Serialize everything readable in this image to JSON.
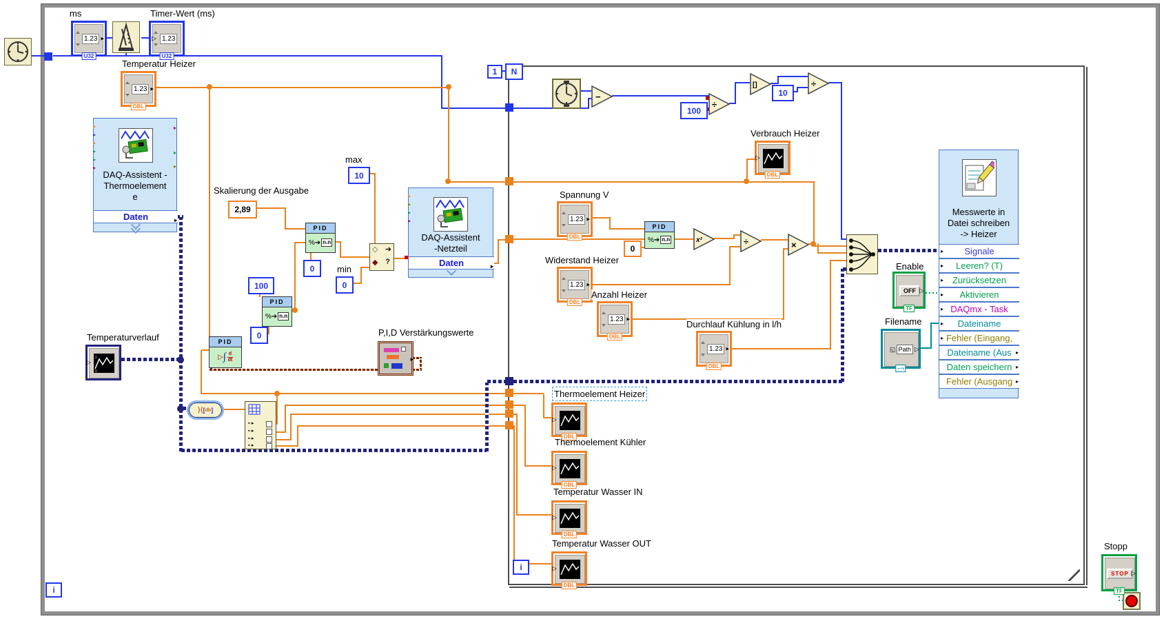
{
  "d": {
    "value_display": "1.23",
    "one": "1",
    "n_label": "N",
    "i_label": "i",
    "ms": {
      "label": "ms",
      "type": "U32"
    },
    "timer": {
      "label": "Timer-Wert (ms)",
      "type": "U32"
    },
    "controls": {
      "temperatur_heizer": {
        "label": "Temperatur Heizer",
        "type": "DBL"
      },
      "spannung": {
        "label": "Spannung V",
        "type": "DBL"
      },
      "widerstand": {
        "label": "Widerstand Heizer",
        "type": "DBL"
      },
      "anzahl": {
        "label": "Anzahl Heizer",
        "type": "DBL"
      },
      "durchlauf": {
        "label": "Durchlauf Kühlung in l/h",
        "type": "DBL"
      }
    },
    "indicators": {
      "verbrauch": {
        "label": "Verbrauch Heizer",
        "type": "DBL"
      },
      "temperaturverlauf": {
        "label": "Temperaturverlauf"
      },
      "thermo_heizer": {
        "label": "Thermoelement Heizer",
        "type": "DBL"
      },
      "thermo_kuehler": {
        "label": "Thermoelement Kühler",
        "type": "DBL"
      },
      "wasser_in": {
        "label": "Temperatur Wasser IN",
        "type": "DBL"
      },
      "wasser_out": {
        "label": "Temperatur Wasser OUT",
        "type": "DBL"
      }
    },
    "constants": {
      "skalierung_label": "Skalierung der Ausgabe",
      "skalierung": "2,89",
      "max_label": "max",
      "ten": "10",
      "min_label": "min",
      "zero": "0",
      "hundred": "100"
    },
    "pid": {
      "header": "PID",
      "scale_glyph": "%",
      "nn": "n.n",
      "gains_label": "P,I,D Verstärkungswerte"
    },
    "ops": {
      "subtract": "−",
      "divide": "÷",
      "index": "[]",
      "square": "x²",
      "multiply": "×"
    },
    "daq_thermo": {
      "line1": "DAQ-Assistent -",
      "line2": "Thermoelement",
      "line3": "e",
      "port": "Daten"
    },
    "daq_netzteil": {
      "line1": "DAQ-Assistent",
      "line2": "-Netzteil",
      "port": "Daten"
    },
    "write_file": {
      "line1": "Messwerte in",
      "line2": "Datei schreiben",
      "line3": "-> Heizer",
      "rows": [
        {
          "label": "Signale",
          "color": "#3838d0"
        },
        {
          "label": "Leeren? (T)",
          "color": "#00a050"
        },
        {
          "label": "Zurücksetzen",
          "color": "#00a050"
        },
        {
          "label": "Aktivieren",
          "color": "#00a050"
        },
        {
          "label": "DAQmx - Task",
          "color": "#b800b8"
        },
        {
          "label": "Dateiname",
          "color": "#008b9b"
        },
        {
          "label": "Fehler (Eingang,",
          "color": "#8f7d00"
        },
        {
          "label": "Dateiname (Aus",
          "color": "#008b9b"
        },
        {
          "label": "Daten speichern",
          "color": "#00a050"
        },
        {
          "label": "Fehler (Ausgang",
          "color": "#8f7d00"
        }
      ]
    },
    "enable": {
      "label": "Enable",
      "state": "OFF",
      "type": "TF"
    },
    "filename": {
      "label": "Filename",
      "value": "Path"
    },
    "stopp": {
      "label": "Stopp",
      "button": "STOP",
      "type": "TF"
    }
  }
}
